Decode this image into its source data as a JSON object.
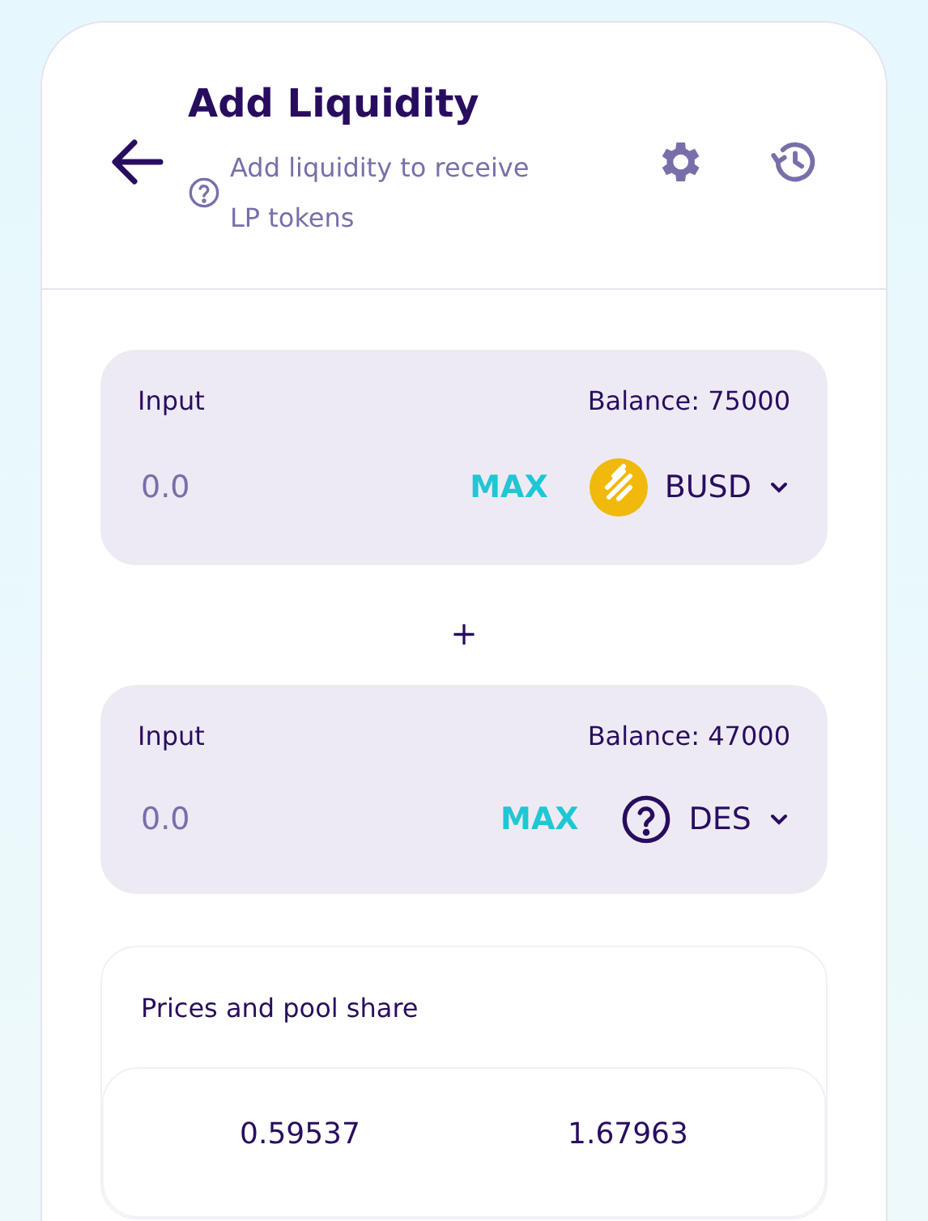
{
  "header": {
    "title": "Add Liquidity",
    "subtitle": "Add liquidity to receive LP tokens"
  },
  "inputs": [
    {
      "label": "Input",
      "balance": "Balance: 75000",
      "placeholder": "0.0",
      "max": "MAX",
      "token": {
        "symbol": "BUSD",
        "kind": "coin"
      }
    },
    {
      "label": "Input",
      "balance": "Balance: 47000",
      "placeholder": "0.0",
      "max": "MAX",
      "token": {
        "symbol": "DES",
        "kind": "unknown"
      }
    }
  ],
  "separator": "+",
  "prices": {
    "title": "Prices and pool share",
    "values": [
      "0.59537",
      "1.67963"
    ]
  }
}
